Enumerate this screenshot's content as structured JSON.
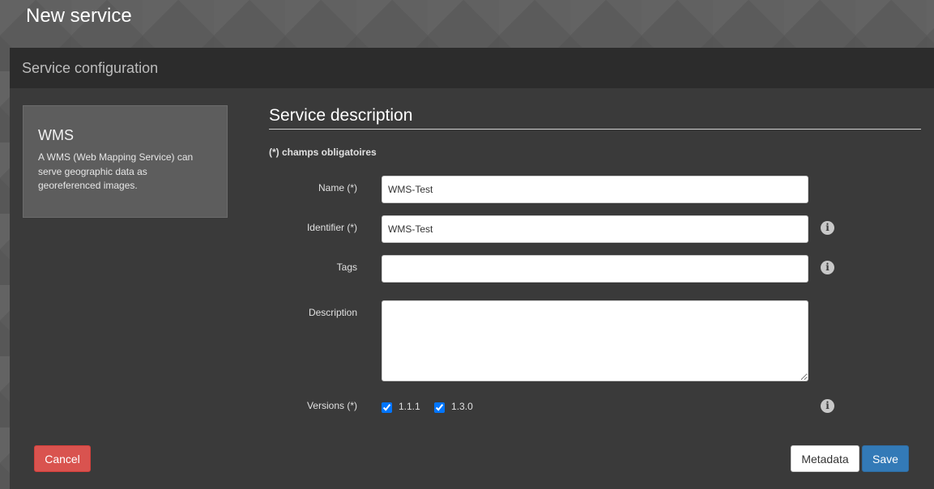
{
  "page": {
    "title": "New service"
  },
  "panel": {
    "header": "Service configuration"
  },
  "service_type": {
    "name": "WMS",
    "description": "A WMS (Web Mapping Service) can serve geographic data as georeferenced images."
  },
  "form": {
    "section_title": "Service description",
    "required_note": "(*) champs obligatoires",
    "name": {
      "label": "Name (*)",
      "value": "WMS-Test"
    },
    "identifier": {
      "label": "Identifier (*)",
      "value": "WMS-Test"
    },
    "tags": {
      "label": "Tags",
      "value": ""
    },
    "description": {
      "label": "Description",
      "value": ""
    },
    "versions": {
      "label": "Versions (*)",
      "options": [
        {
          "label": "1.1.1",
          "checked": true
        },
        {
          "label": "1.3.0",
          "checked": true
        }
      ]
    },
    "info_icon_glyph": "i"
  },
  "actions": {
    "cancel": "Cancel",
    "metadata": "Metadata",
    "save": "Save"
  },
  "colors": {
    "panel_bg": "#3a3a3a",
    "header_bg": "#2c2c2c",
    "cancel": "#d9534f",
    "save": "#337ab7"
  },
  "icons": {
    "info": "info-circle-icon"
  }
}
